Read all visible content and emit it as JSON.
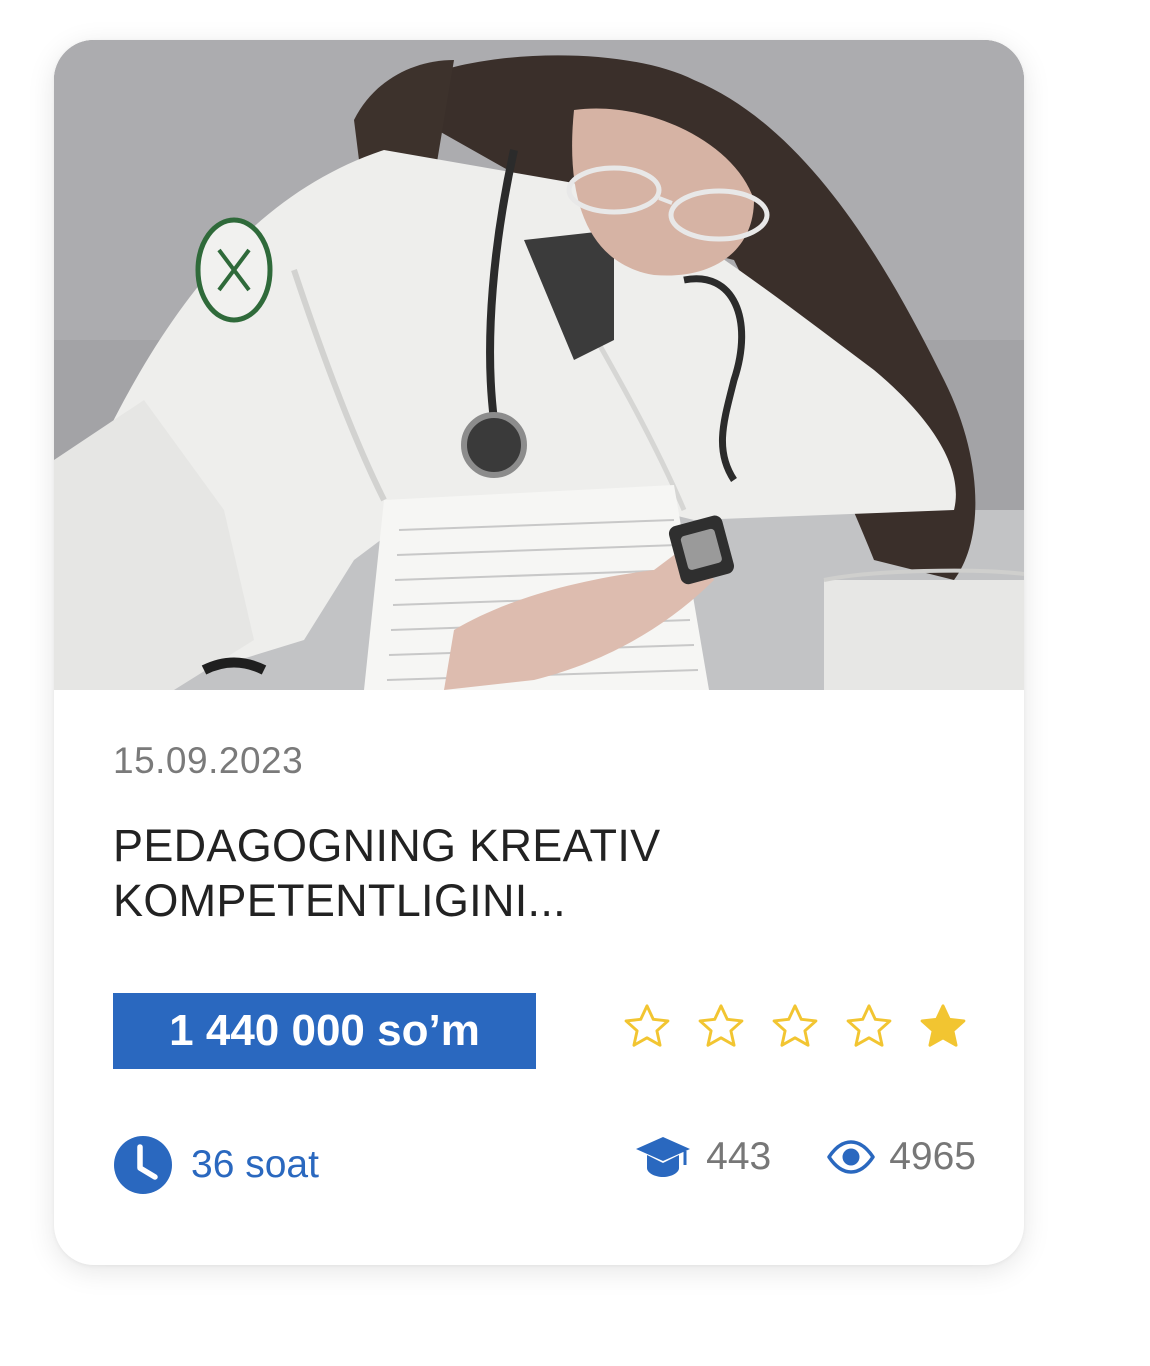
{
  "course_card": {
    "image_alt": "Student in white lab coat reading documents",
    "date": "15.09.2023",
    "title_line1": "PEDAGOGNING KREATIV",
    "title_line2": "KOMPETENTLIGINI...",
    "price": "1 440 000 so’m",
    "rating": {
      "stars": [
        {
          "icon": "star-outline-icon",
          "filled": false
        },
        {
          "icon": "star-outline-icon",
          "filled": false
        },
        {
          "icon": "star-outline-icon",
          "filled": false
        },
        {
          "icon": "star-outline-icon",
          "filled": false
        },
        {
          "icon": "star-filled-icon",
          "filled": true
        }
      ]
    },
    "duration": {
      "icon": "clock-icon",
      "text": "36 soat"
    },
    "students": {
      "icon": "graduation-cap-icon",
      "count": "443"
    },
    "views": {
      "icon": "eye-icon",
      "count": "4965"
    }
  },
  "colors": {
    "accent": "#2a68bf",
    "star": "#f2c531",
    "muted_text": "#777777",
    "title_text": "#222222"
  }
}
